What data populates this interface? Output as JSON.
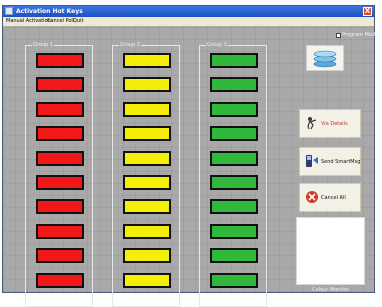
{
  "window": {
    "title": "Activation Hot Keys",
    "close_label": "X"
  },
  "menu": [
    "Manual Activation",
    "Cancel Poll",
    "Quit"
  ],
  "groups": [
    {
      "label": "Group 1",
      "color": "#f01818",
      "key_count": 10
    },
    {
      "label": "Group 2",
      "color": "#f5ee0a",
      "key_count": 10
    },
    {
      "label": "Group 3",
      "color": "#2fb83c",
      "key_count": 10
    }
  ],
  "program_mode": {
    "label": "Program Mode",
    "checked": false
  },
  "logo_icon": "stacked-discs-logo",
  "actions": [
    {
      "id": "test",
      "label": "Via Details",
      "icon": "person-pointing-icon",
      "label_color": "#c03030"
    },
    {
      "id": "send",
      "label": "Send SmartMsg",
      "icon": "smartmsg-icon",
      "label_color": "#111111"
    },
    {
      "id": "cancel",
      "label": "Cancel All",
      "icon": "cancel-all-icon",
      "label_color": "#111111"
    }
  ],
  "monitor": {
    "label": "Colour Monitor"
  }
}
